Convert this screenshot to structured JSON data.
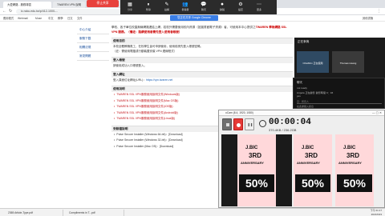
{
  "browser": {
    "tabs": [
      "大愛網路 - 服務專區",
      "TWAREN VPN 說明"
    ],
    "url": "ic.ncku.edu.tw/p/412-1000-...",
    "bookmarks": [
      "應用程式",
      "Webmail",
      "Muse",
      "中文",
      "教學",
      "日文",
      "文件",
      "其他書籤"
    ]
  },
  "recorder_bar": {
    "pill": "停止共享",
    "buttons": [
      {
        "icon": "▦",
        "label": "分享"
      },
      {
        "icon": "⏸",
        "label": "暫停"
      },
      {
        "icon": "✎",
        "label": "註解"
      },
      {
        "icon": "👥",
        "label": "參與者"
      },
      {
        "icon": "💬",
        "label": "聊天"
      },
      {
        "icon": "⏺",
        "label": "錄製"
      },
      {
        "icon": "⚙",
        "label": "設定"
      },
      {
        "icon": "⋯",
        "label": "更多"
      }
    ],
    "share_banner": "您正在共享 Google Chrome"
  },
  "leftnav": {
    "items": [
      "中心介紹",
      "服務下載",
      "相關法規",
      "常見問題"
    ]
  },
  "article": {
    "intro": "學校、各子單位校園無線網路連結上網，若校外需要使用校內資源（如圖書館電子資源）者，可使用本中心提供之",
    "intro_link": "TWAREN 學術網路 SSL VPN 服務。（備註：路網使用者需先登入使用者帳號）",
    "sections": {
      "s1_title": "使用目的",
      "s1_text": "本校全體教職員工、在校學生皆可申請使用，使用前請先登入帳號密碼。",
      "s1_text2": "（註：需使用電腦或行動裝置安裝 VPN 連線程式）",
      "s2_title": "登入帳號",
      "s2_text": "請使用成功入口帳號登入。",
      "s3_title": "登入網址",
      "s3_label": "登入頁面位址網址(URL)：",
      "s3_url": "https://vpn.twaren.net",
      "s4_title": "使用說明",
      "s5_title": "安裝檔說明"
    },
    "guides": [
      "TWAREN SSL VPN服務使用說明文件(Windows版)",
      "TWAREN SSL VPN服務使用說明文件(Mac OS版)",
      "TWAREN SSL VPN服務使用說明文件(iOS版)",
      "TWAREN SSL VPN服務使用說明文件(Android版)",
      "TWAREN SSL VPN服務使用說明文件(Linux版)"
    ],
    "downloads": [
      "Pulse Secure Installer (Windows 64-bit)：[Download]",
      "Pulse Secure Installer (Windows 32-bit)：[Download]",
      "Pulse Secure Installer (Mac OS)：[Download]"
    ]
  },
  "meeting": {
    "title": "正在參與",
    "tile1": "ChiaShin 正在使用",
    "tile2": "Thomas Huang"
  },
  "chat": {
    "title": "聊天",
    "messages": [
      "not ready",
      "Angela 正在錄影 錄影時間 9：03",
      "yes"
    ],
    "input_placeholder": "至：所有人",
    "footer": "在此處鍵入訊息"
  },
  "recorder": {
    "title": "oCam (8.4, 1920, 1080)",
    "time": "00:00:04",
    "size": "370.4KB / 236.2GB",
    "ad_logo": "J.BIC",
    "ad_num": "3RD",
    "ad_word": "ANNIVERSARY",
    "ad_off": "50%"
  },
  "taskbar": {
    "items": [
      "2365 Article-Type.pdf",
      "Compliments in T...pdf"
    ],
    "time": "下午 01:17",
    "date": "2021/6/23"
  }
}
